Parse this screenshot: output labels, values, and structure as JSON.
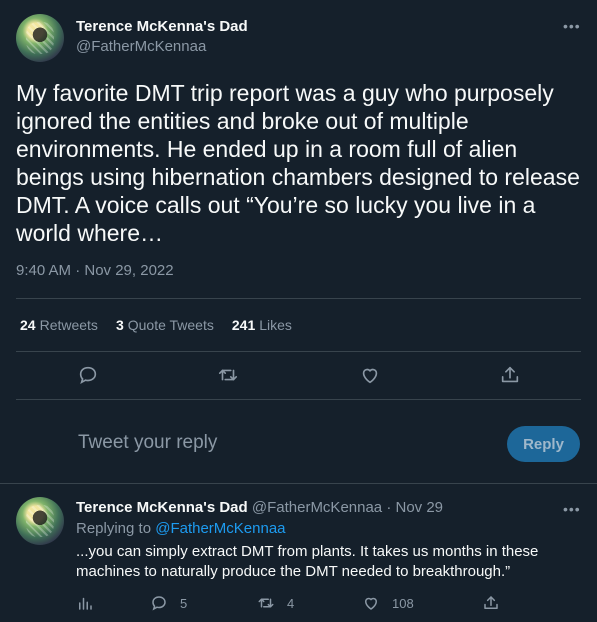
{
  "tweet": {
    "author_name": "Terence McKenna's Dad",
    "author_handle": "@FatherMcKennaa",
    "text": "My favorite DMT trip report was a guy who purposely ignored the entities and broke out of multiple environments. He ended up in a room full of alien beings using hibernation chambers designed to release DMT. A voice calls out “You’re so lucky you live in a world where…",
    "timestamp": "9:40 AM · Nov 29, 2022",
    "stats": {
      "retweets_count": "24",
      "retweets_label": "Retweets",
      "quotes_count": "3",
      "quotes_label": "Quote Tweets",
      "likes_count": "241",
      "likes_label": "Likes"
    }
  },
  "reply_box": {
    "placeholder": "Tweet your reply",
    "button_label": "Reply"
  },
  "reply": {
    "author_name": "Terence McKenna's Dad",
    "author_handle": "@FatherMcKennaa",
    "date": "· Nov 29",
    "replying_prefix": "Replying to",
    "replying_to": "@FatherMcKennaa",
    "text": "...you can simply extract DMT from plants. It takes us months in these machines to naturally produce the DMT needed to breakthrough.”",
    "reply_count": "5",
    "retweet_count": "4",
    "like_count": "108"
  },
  "colors": {
    "background": "#15202b",
    "accent": "#1d9bf0",
    "muted": "#8b98a5"
  },
  "icons": [
    "more-icon",
    "reply-icon",
    "retweet-icon",
    "like-icon",
    "share-icon",
    "analytics-icon"
  ]
}
